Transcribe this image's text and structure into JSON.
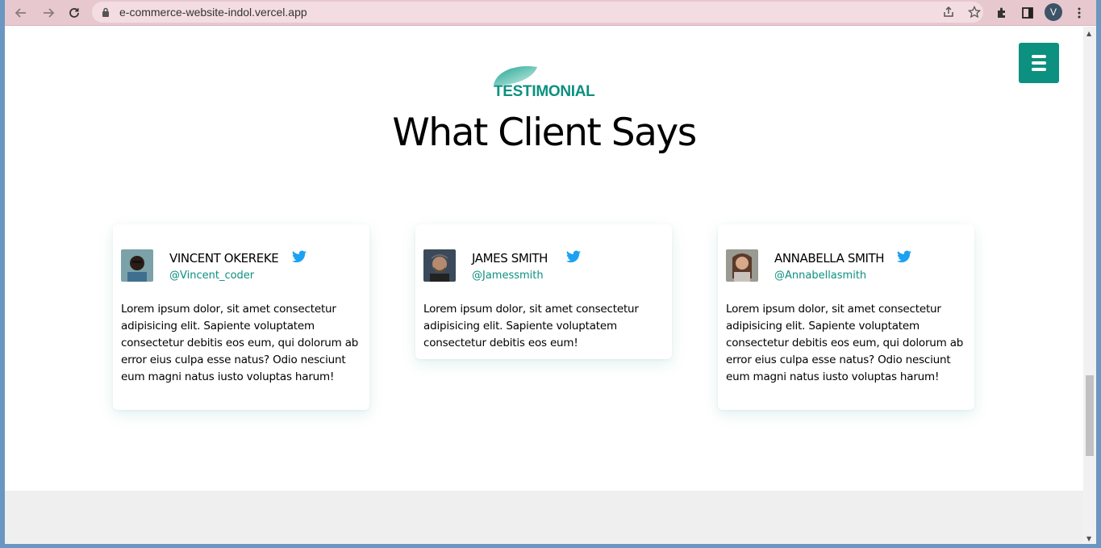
{
  "browser": {
    "url": "e-commerce-website-indol.vercel.app",
    "profile_initial": "V",
    "icons": [
      "back-icon",
      "forward-icon",
      "reload-icon",
      "lock-icon",
      "share-icon",
      "star-icon",
      "extensions-icon",
      "side-panel-icon",
      "kebab-menu-icon"
    ]
  },
  "section": {
    "eyebrow": "TESTIMONIAL",
    "title": "What Client Says"
  },
  "testimonials": [
    {
      "name": "VINCENT OKEREKE",
      "handle": "@Vincent_coder",
      "text": "Lorem ipsum dolor, sit amet consectetur adipisicing elit. Sapiente voluptatem consectetur debitis eos eum, qui dolorum ab error eius culpa esse natus? Odio nesciunt eum magni natus iusto voluptas harum!"
    },
    {
      "name": "JAMES SMITH",
      "handle": "@Jamessmith",
      "text": "Lorem ipsum dolor, sit amet consectetur adipisicing elit. Sapiente voluptatem consectetur debitis eos eum!"
    },
    {
      "name": "ANNABELLA SMITH",
      "handle": "@Annabellasmith",
      "text": "Lorem ipsum dolor, sit amet consectetur adipisicing elit. Sapiente voluptatem consectetur debitis eos eum, qui dolorum ab error eius culpa esse natus? Odio nesciunt eum magni natus iusto voluptas harum!"
    }
  ],
  "colors": {
    "accent": "#0c9080",
    "twitter": "#1da1f2",
    "toolbar": "#e8c8cf"
  }
}
